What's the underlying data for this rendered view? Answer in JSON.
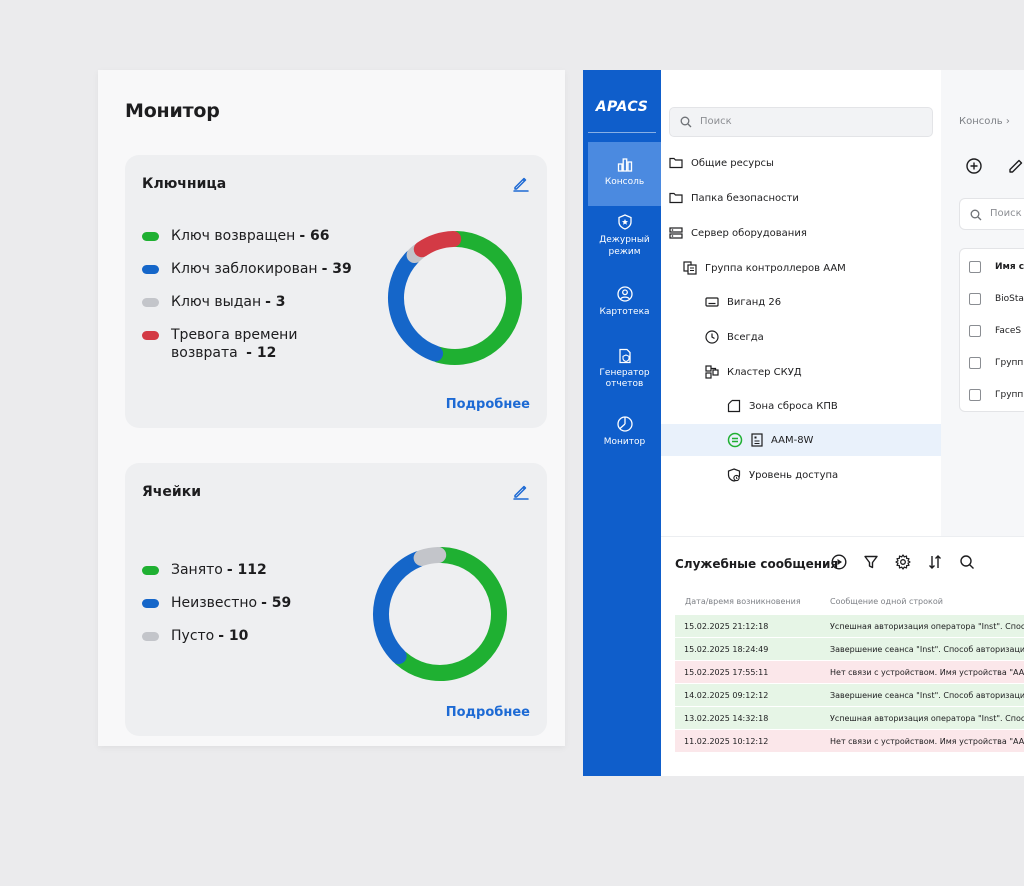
{
  "colors": {
    "green": "#1fb032",
    "blue": "#1566c9",
    "gray": "#c3c5ca",
    "red": "#d33a45",
    "accent": "#0f5ecb"
  },
  "monitor": {
    "title": "Монитор",
    "widgets": [
      {
        "title": "Ключница",
        "more": "Подробнее",
        "legend": [
          {
            "label": "Ключ возвращен",
            "value": "- 66"
          },
          {
            "label": "Ключ заблокирован",
            "value": "- 39"
          },
          {
            "label": "Ключ выдан ",
            "value": " - 3"
          },
          {
            "label_line1": "Тревога времени",
            "label_line2": "возврата",
            "value": "- 12"
          }
        ]
      },
      {
        "title": "Ячейки",
        "more": "Подробнее",
        "legend": [
          {
            "label": "Занято",
            "value": "- 112"
          },
          {
            "label": "Неизвестно ",
            "value": " - 59"
          },
          {
            "label": "Пусто ",
            "value": " - 10"
          }
        ]
      }
    ]
  },
  "chart_data": [
    {
      "type": "pie",
      "title": "Ключница",
      "categories": [
        "Ключ возвращен",
        "Ключ заблокирован",
        "Ключ выдан",
        "Тревога времени возврата"
      ],
      "values": [
        66,
        39,
        3,
        12
      ],
      "colors": [
        "#1fb032",
        "#1566c9",
        "#c3c5ca",
        "#d33a45"
      ]
    },
    {
      "type": "pie",
      "title": "Ячейки",
      "categories": [
        "Занято",
        "Неизвестно",
        "Пусто"
      ],
      "values": [
        112,
        59,
        10
      ],
      "colors": [
        "#1fb032",
        "#1566c9",
        "#c3c5ca"
      ]
    }
  ],
  "app": {
    "logo": "APACS",
    "nav": [
      {
        "label": "Консоль",
        "icon": "console-icon",
        "active": true
      },
      {
        "label": "Дежурный режим",
        "icon": "duty-icon"
      },
      {
        "label": "Картотека",
        "icon": "card-index-icon"
      },
      {
        "label": "Генератор отчетов",
        "icon": "report-icon"
      },
      {
        "label": "Монитор",
        "icon": "monitor-icon"
      }
    ],
    "search_placeholder": "Поиск",
    "tree": [
      "Общие ресурсы",
      "Папка безопасности",
      "Сервер оборудования",
      "Группа контроллеров AAM",
      "Виганд 26",
      "Всегда",
      "Кластер СКУД",
      "Зона сброса КПВ",
      "AAM-8W",
      "Уровень доступа"
    ],
    "breadcrumb": "Консоль  ›",
    "right_search_placeholder": "Поиск",
    "table": [
      "Имя с",
      "BioSta",
      "FaceS",
      "Групп",
      "Групп"
    ],
    "log": {
      "title": "Служебные сообщения",
      "col_time": "Дата/время возникновения",
      "col_msg": "Сообщение одной строкой",
      "rows": [
        {
          "time": "15.02.2025 21:12:18",
          "msg": "Успешная авторизация оператора \"Inst\". Спосо",
          "status": "ok"
        },
        {
          "time": "15.02.2025 18:24:49",
          "msg": "Завершение сеанса \"Inst\". Способ авторизаци",
          "status": "ok"
        },
        {
          "time": "15.02.2025 17:55:11",
          "msg": "Нет связи с устройством. Имя устройства \"AAM",
          "status": "err"
        },
        {
          "time": "14.02.2025 09:12:12",
          "msg": "Завершение сеанса \"Inst\". Способ авторизаци",
          "status": "ok"
        },
        {
          "time": "13.02.2025 14:32:18",
          "msg": "Успешная авторизация оператора \"Inst\". Спосо",
          "status": "ok"
        },
        {
          "time": "11.02.2025 10:12:12",
          "msg": "Нет связи с устройством. Имя устройства \"AAM",
          "status": "err"
        }
      ]
    }
  }
}
